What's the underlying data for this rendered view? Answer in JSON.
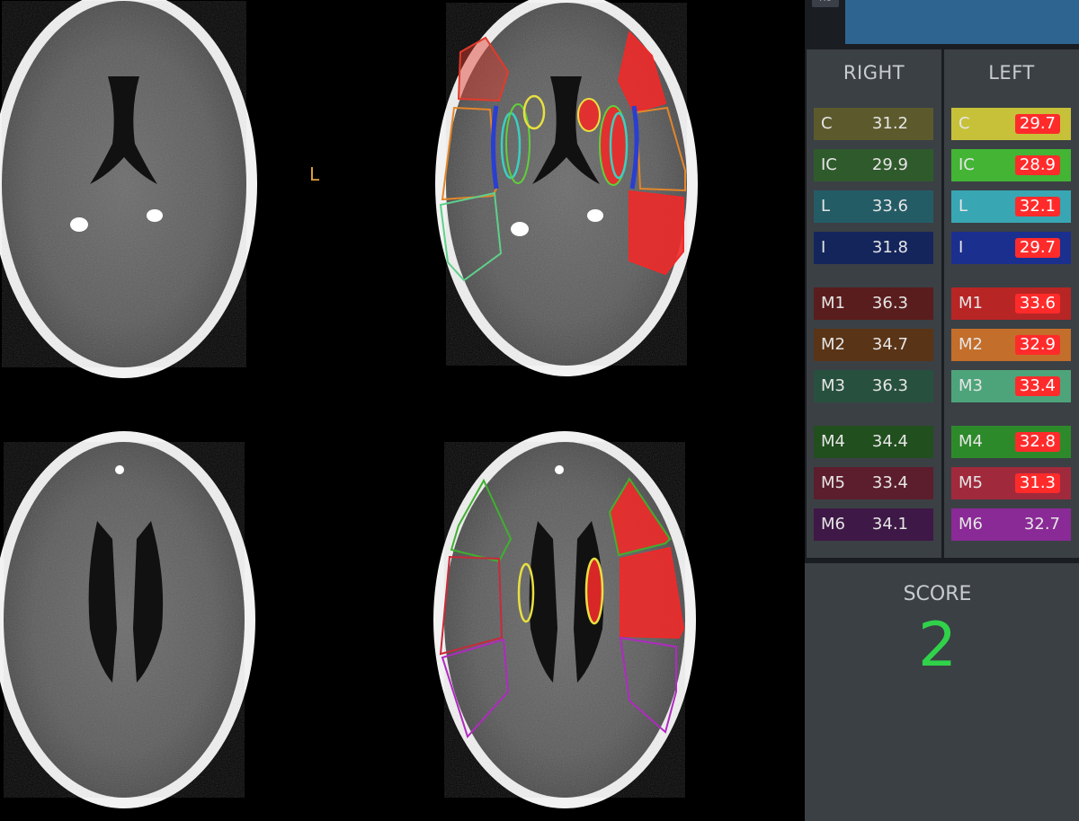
{
  "viewer": {
    "orientation_label": "L"
  },
  "panel": {
    "top_button_label": "Ho",
    "right_header": "RIGHT",
    "left_header": "LEFT",
    "regions": [
      {
        "label": "C",
        "right": "31.2",
        "left": "29.7",
        "left_flag": true,
        "right_color": "#5c5a2c",
        "left_color": "#c7c13a"
      },
      {
        "label": "IC",
        "right": "29.9",
        "left": "28.9",
        "left_flag": true,
        "right_color": "#2f5a2c",
        "left_color": "#43b434"
      },
      {
        "label": "L",
        "right": "33.6",
        "left": "32.1",
        "left_flag": true,
        "right_color": "#245c66",
        "left_color": "#38a7b3"
      },
      {
        "label": "I",
        "right": "31.8",
        "left": "29.7",
        "left_flag": true,
        "right_color": "#14255c",
        "left_color": "#1b2f8f"
      },
      {
        "label": "M1",
        "right": "36.3",
        "left": "33.6",
        "left_flag": true,
        "right_color": "#5a1d1d",
        "left_color": "#b82525"
      },
      {
        "label": "M2",
        "right": "34.7",
        "left": "32.9",
        "left_flag": true,
        "right_color": "#5a3416",
        "left_color": "#c36e2a"
      },
      {
        "label": "M3",
        "right": "36.3",
        "left": "33.4",
        "left_flag": true,
        "right_color": "#27513e",
        "left_color": "#4ea47a"
      },
      {
        "label": "M4",
        "right": "34.4",
        "left": "32.8",
        "left_flag": true,
        "right_color": "#214f1e",
        "left_color": "#2d8a2a"
      },
      {
        "label": "M5",
        "right": "33.4",
        "left": "31.3",
        "left_flag": true,
        "right_color": "#5c1d2c",
        "left_color": "#a02a3c"
      },
      {
        "label": "M6",
        "right": "34.1",
        "left": "32.7",
        "left_flag": false,
        "right_color": "#3e1846",
        "left_color": "#8a2a96"
      }
    ],
    "score_label": "SCORE",
    "score_value": "2"
  }
}
